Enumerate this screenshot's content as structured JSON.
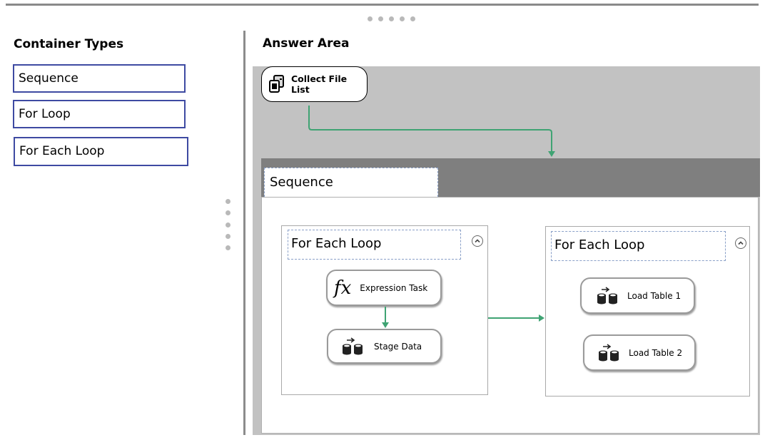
{
  "left_panel": {
    "title": "Container Types",
    "items": [
      "Sequence",
      "For Loop",
      "For Each Loop"
    ]
  },
  "answer_area": {
    "title": "Answer Area",
    "collect_task": "Collect File List",
    "sequence_label": "Sequence",
    "loop1": {
      "label": "For Each Loop",
      "tasks": [
        "Expression Task",
        "Stage Data"
      ]
    },
    "loop2": {
      "label": "For Each Loop",
      "tasks": [
        "Load Table 1",
        "Load Table 2"
      ]
    }
  },
  "colors": {
    "connector": "#3fa373",
    "item_border": "#3e4aa2",
    "canvas": "#c2c2c2",
    "sequence_band": "#7f7f7f"
  },
  "icons": {
    "drag_handle": "dots-icon",
    "collect": "file-system-task-icon",
    "expression": "fx-icon",
    "data_flow": "data-flow-icon",
    "collapse": "chevron-up-icon"
  }
}
